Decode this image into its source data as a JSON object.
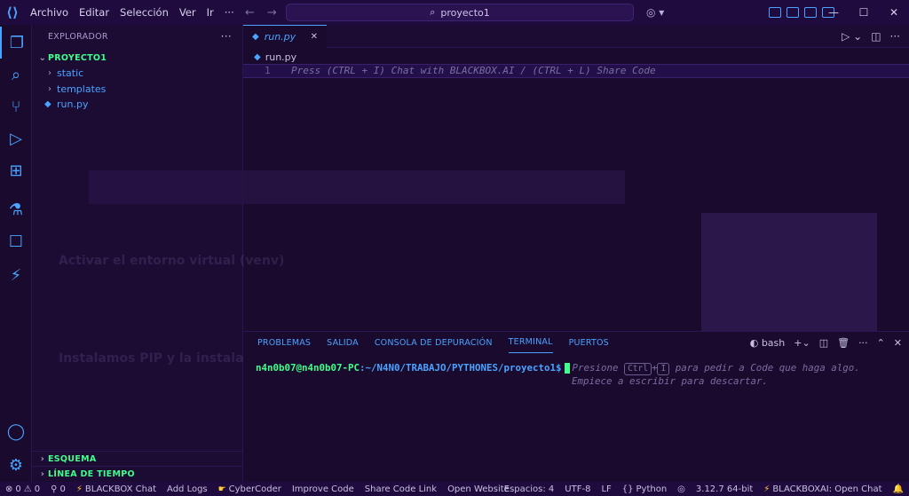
{
  "titlebar": {
    "menu": [
      "Archivo",
      "Editar",
      "Selección",
      "Ver",
      "Ir",
      "···"
    ],
    "search_text": "proyecto1"
  },
  "sidebar": {
    "title": "EXPLORADOR",
    "project": "PROYECTO1",
    "items": [
      {
        "label": "static",
        "type": "folder"
      },
      {
        "label": "templates",
        "type": "folder"
      },
      {
        "label": "run.py",
        "type": "file"
      }
    ],
    "outline": "ESQUEMA",
    "timeline": "LÍNEA DE TIEMPO"
  },
  "editor": {
    "tab_label": "run.py",
    "breadcrumb": "run.py",
    "line_number": "1",
    "line_text": "Press (CTRL + I) Chat with BLACKBOX.AI / (CTRL + L) Share Code"
  },
  "panel": {
    "tabs": [
      "PROBLEMAS",
      "SALIDA",
      "CONSOLA DE DEPURACIÓN",
      "TERMINAL",
      "PUERTOS"
    ],
    "active_tab": "TERMINAL",
    "shell": "bash",
    "prompt_user": "n4n0b07@n4n0b07-PC",
    "prompt_path": ":~/N4N0/TRABAJO/PYTHONES/proyecto1",
    "prompt_symbol": "$",
    "hint_pre": "Presione",
    "hint_key1": "Ctrl",
    "hint_plus": "+",
    "hint_key2": "I",
    "hint_post": "para pedir a Code que haga algo.",
    "hint_line2": "Empiece a escribir para descartar."
  },
  "statusbar": {
    "errors": "0",
    "warnings": "0",
    "ports": "0",
    "blackbox_chat": "BLACKBOX Chat",
    "add_logs": "Add Logs",
    "cybercoder": "CyberCoder",
    "improve_code": "Improve Code",
    "share_code_link": "Share Code Link",
    "open_website": "Open Website",
    "spaces": "Espacios: 4",
    "encoding": "UTF-8",
    "eol": "LF",
    "language": "Python",
    "interpreter": "3.12.7 64-bit",
    "blackbox_open_chat": "BLACKBOXAI: Open Chat"
  },
  "background_ghost": {
    "heading1": "Activar el entorno virtual (venv)",
    "heading2": "Instalamos PIP y la instalación de Flask"
  },
  "colors": {
    "accent": "#4aa3ff",
    "green": "#3fff8a",
    "background": "#1a0a2e"
  }
}
